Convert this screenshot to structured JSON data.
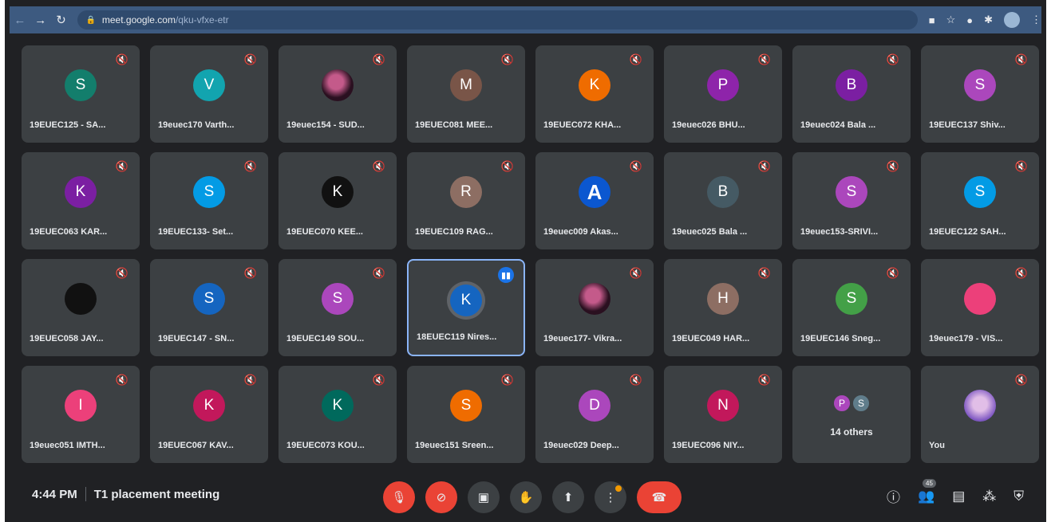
{
  "browser": {
    "url_domain": "meet.google.com",
    "url_path": "/qku-vfxe-etr"
  },
  "tiles": [
    {
      "initial": "S",
      "name": "19EUEC125 - SA...",
      "color": "#137e6c"
    },
    {
      "initial": "V",
      "name": "19euec170 Varth...",
      "color": "#12a4af"
    },
    {
      "initial": "",
      "name": "19euec154 - SUD...",
      "color": "#2a1020",
      "photo": true
    },
    {
      "initial": "M",
      "name": "19EUEC081 MEE...",
      "color": "#795548"
    },
    {
      "initial": "K",
      "name": "19EUEC072 KHA...",
      "color": "#ef6c00"
    },
    {
      "initial": "P",
      "name": "19euec026 BHU...",
      "color": "#8e24aa"
    },
    {
      "initial": "B",
      "name": "19euec024 Bala ...",
      "color": "#7b1fa2"
    },
    {
      "initial": "S",
      "name": "19EUEC137 Shiv...",
      "color": "#ab47bc"
    },
    {
      "initial": "K",
      "name": "19EUEC063 KAR...",
      "color": "#7b1fa2"
    },
    {
      "initial": "S",
      "name": "19EUEC133- Set...",
      "color": "#039be5"
    },
    {
      "initial": "K",
      "name": "19EUEC070 KEE...",
      "color": "#111111",
      "dark": true
    },
    {
      "initial": "R",
      "name": "19EUEC109 RAG...",
      "color": "#8d6e63"
    },
    {
      "initial": "A",
      "name": "19euec009 Akas...",
      "color": "#0b57d0",
      "biga": true
    },
    {
      "initial": "B",
      "name": "19euec025 Bala ...",
      "color": "#455a64"
    },
    {
      "initial": "S",
      "name": "19euec153-SRIVI...",
      "color": "#ab47bc"
    },
    {
      "initial": "S",
      "name": "19EUEC122 SAH...",
      "color": "#039be5"
    },
    {
      "initial": "",
      "name": "19EUEC058 JAY...",
      "color": "#111111",
      "dark": true
    },
    {
      "initial": "S",
      "name": "19EUEC147 - SN...",
      "color": "#1565c0"
    },
    {
      "initial": "S",
      "name": "19EUEC149 SOU...",
      "color": "#ab47bc"
    },
    {
      "initial": "K",
      "name": "18EUEC119 Nires...",
      "color": "#1565c0",
      "speaking": true
    },
    {
      "initial": "",
      "name": "19euec177- Vikra...",
      "color": "#3e2723",
      "photo": true
    },
    {
      "initial": "H",
      "name": "19EUEC049 HAR...",
      "color": "#8d6e63"
    },
    {
      "initial": "S",
      "name": "19EUEC146 Sneg...",
      "color": "#43a047"
    },
    {
      "initial": "",
      "name": "19euec179 - VIS...",
      "color": "#ec407a"
    },
    {
      "initial": "I",
      "name": "19euec051 IMTH...",
      "color": "#ec407a"
    },
    {
      "initial": "K",
      "name": "19EUEC067 KAV...",
      "color": "#c2185b"
    },
    {
      "initial": "K",
      "name": "19EUEC073 KOU...",
      "color": "#00695c"
    },
    {
      "initial": "S",
      "name": "19euec151 Sreen...",
      "color": "#ef6c00"
    },
    {
      "initial": "D",
      "name": "19euec029 Deep...",
      "color": "#ab47bc"
    },
    {
      "initial": "N",
      "name": "19EUEC096 NIY...",
      "color": "#c2185b"
    }
  ],
  "others": {
    "label": "14 others",
    "avatars": [
      {
        "initial": "P",
        "color": "#ab47bc"
      },
      {
        "initial": "S",
        "color": "#607d8b"
      }
    ]
  },
  "you": {
    "name": "You"
  },
  "meeting": {
    "time": "4:44 PM",
    "title": "T1 placement meeting"
  },
  "people_count": "45",
  "icons": {
    "mic": "mic-off-icon",
    "cam": "camera-off-icon",
    "captions": "captions-icon",
    "hand": "raise-hand-icon",
    "present": "present-icon",
    "more": "more-options-icon",
    "end": "end-call-icon",
    "info": "info-icon",
    "people": "people-icon",
    "chat": "chat-icon",
    "activities": "activities-icon",
    "host": "host-controls-icon"
  }
}
